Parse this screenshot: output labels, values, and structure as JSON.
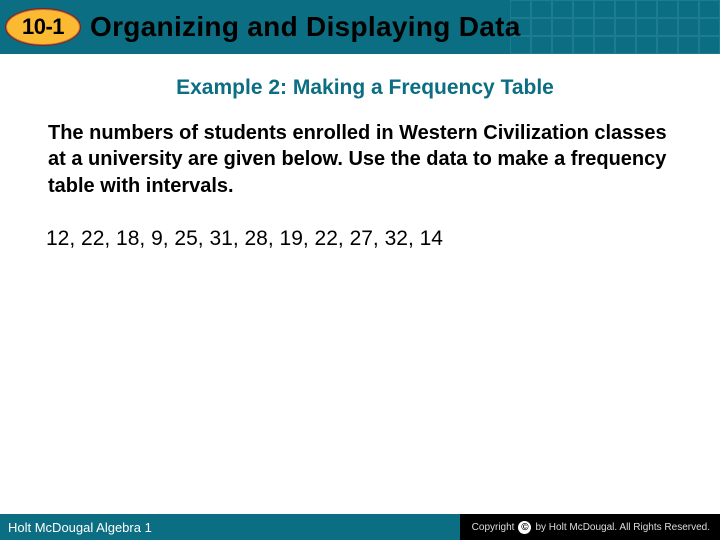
{
  "header": {
    "lesson_number": "10-1",
    "title": "Organizing and Displaying Data"
  },
  "content": {
    "example_heading": "Example 2: Making a Frequency Table",
    "problem_text": "The numbers of students enrolled in Western Civilization classes at a university are given below. Use the data to make a frequency table with intervals.",
    "data_values": "12, 22, 18, 9, 25, 31, 28, 19, 22, 27, 32, 14"
  },
  "footer": {
    "book": "Holt McDougal Algebra 1",
    "copyright": "by Holt McDougal. All Rights Reserved."
  }
}
